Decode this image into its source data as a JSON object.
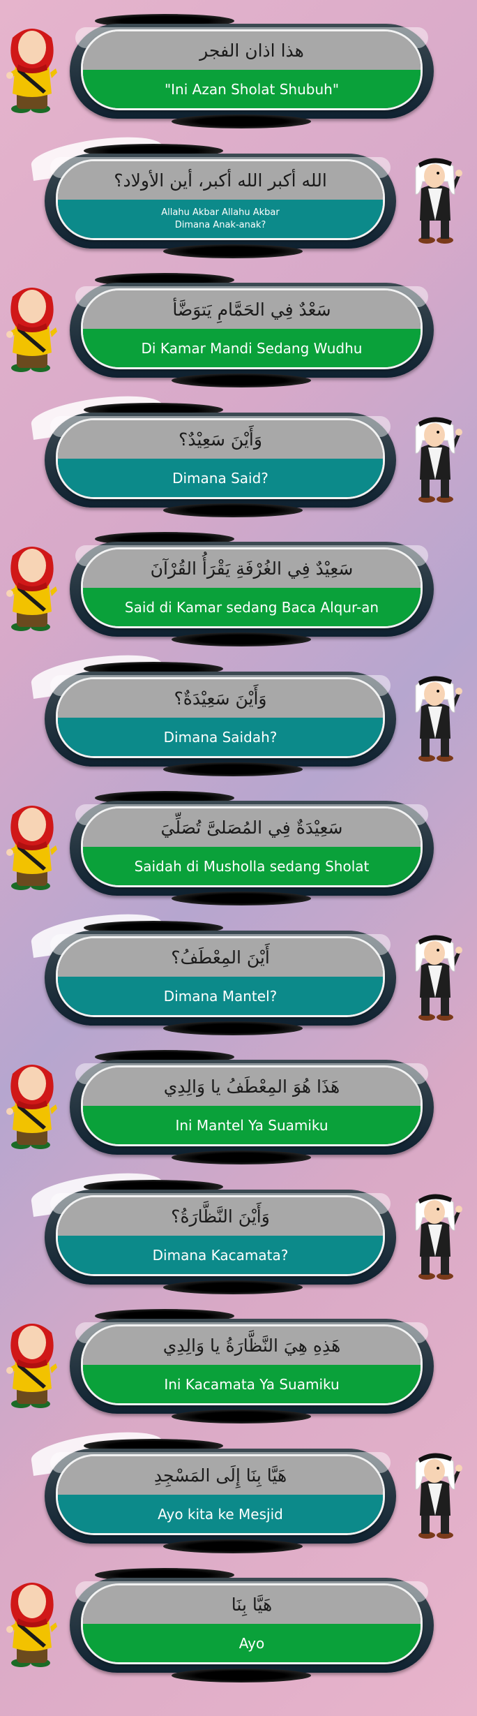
{
  "dialogue": [
    {
      "speaker": "girl",
      "arabic": "هذا  اذان الفجر",
      "latin": "\"Ini Azan Sholat Shubuh\"",
      "small": false
    },
    {
      "speaker": "man",
      "arabic": "الله أكبر الله أكبر، أين الأولاد؟",
      "latin": "Allahu Akbar Allahu Akbar\nDimana Anak-anak?",
      "small": true
    },
    {
      "speaker": "girl",
      "arabic": "سَعْدٌ فِي الحَمَّامِ يَتوَضَّأ",
      "latin": "Di Kamar Mandi Sedang Wudhu",
      "small": false
    },
    {
      "speaker": "man",
      "arabic": "وَأَيْنَ سَعِيْدٌ؟",
      "latin": "Dimana Said?",
      "small": false
    },
    {
      "speaker": "girl",
      "arabic": "سَعِيْدٌ فِي الغُرْفَةِ يَقْرَأُ القُرْآنَ",
      "latin": "Said di Kamar sedang Baca Alqur-an",
      "small": false
    },
    {
      "speaker": "man",
      "arabic": "وَأَيْنَ سَعِيْدَةٌ؟",
      "latin": "Dimana Saidah?",
      "small": false
    },
    {
      "speaker": "girl",
      "arabic": "سَعِيْدَةٌ فِي المُصَلىَّ تُصَلِّيَ",
      "latin": "Saidah di Musholla sedang Sholat",
      "small": false
    },
    {
      "speaker": "man",
      "arabic": "أَيْنَ المِعْطَفُ؟",
      "latin": "Dimana Mantel?",
      "small": false
    },
    {
      "speaker": "girl",
      "arabic": "هَذَا هُوَ المِعْطَفُ يا وَالِدِي",
      "latin": "Ini Mantel Ya Suamiku",
      "small": false
    },
    {
      "speaker": "man",
      "arabic": "وَأَيْنَ النَّظَّارَةُ؟",
      "latin": "Dimana Kacamata?",
      "small": false
    },
    {
      "speaker": "girl",
      "arabic": "هَذِهِ هِيَ النَّظَّارَةُ يا وَالِدِي",
      "latin": "Ini Kacamata Ya Suamiku",
      "small": false
    },
    {
      "speaker": "man",
      "arabic": "هَيَّا بِنَا إِلَى المَسْجِدِ",
      "latin": "Ayo kita ke Mesjid",
      "small": false
    },
    {
      "speaker": "girl",
      "arabic": "هَيَّا بِنَا",
      "latin": "Ayo",
      "small": false
    }
  ],
  "colors": {
    "girl_bottom": "#0aa13a",
    "man_bottom": "#0c8a8a",
    "top_bar": "#a8a8a8",
    "frame": "#0e2130"
  },
  "icons": {
    "girl": "hijab-girl-icon",
    "man": "keffiyeh-man-icon"
  }
}
